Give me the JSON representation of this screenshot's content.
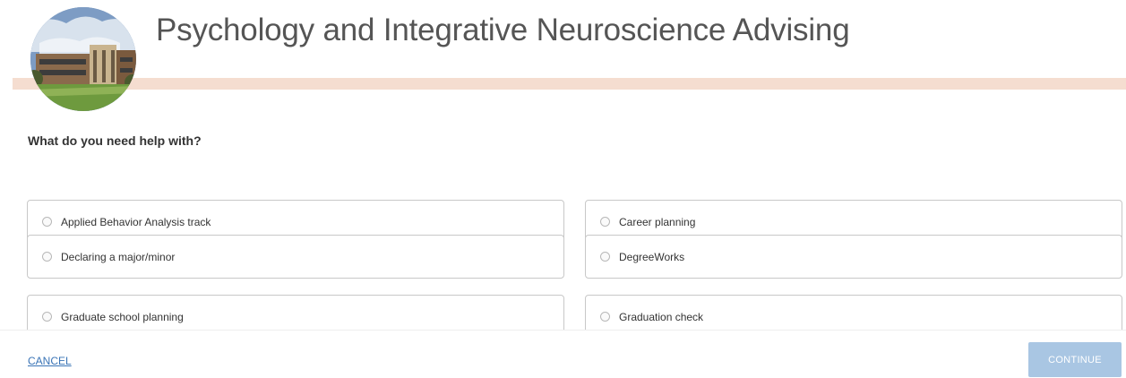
{
  "header": {
    "title": "Psychology and Integrative Neuroscience Advising",
    "avatar_icon": "building-photo-icon",
    "band_color": "#f5ddd0"
  },
  "form": {
    "question": "What do you need help with?",
    "options": [
      {
        "label": "Applied Behavior Analysis track",
        "selected": false
      },
      {
        "label": "Career planning",
        "selected": false
      },
      {
        "label": "Declaring a major/minor",
        "selected": false
      },
      {
        "label": "DegreeWorks",
        "selected": false
      },
      {
        "label": "Graduate school planning",
        "selected": false
      },
      {
        "label": "Graduation check",
        "selected": false
      }
    ]
  },
  "footer": {
    "cancel_label": "CANCEL",
    "continue_label": "CONTINUE",
    "link_color": "#3a74b6",
    "continue_color": "#a9c6e3"
  }
}
